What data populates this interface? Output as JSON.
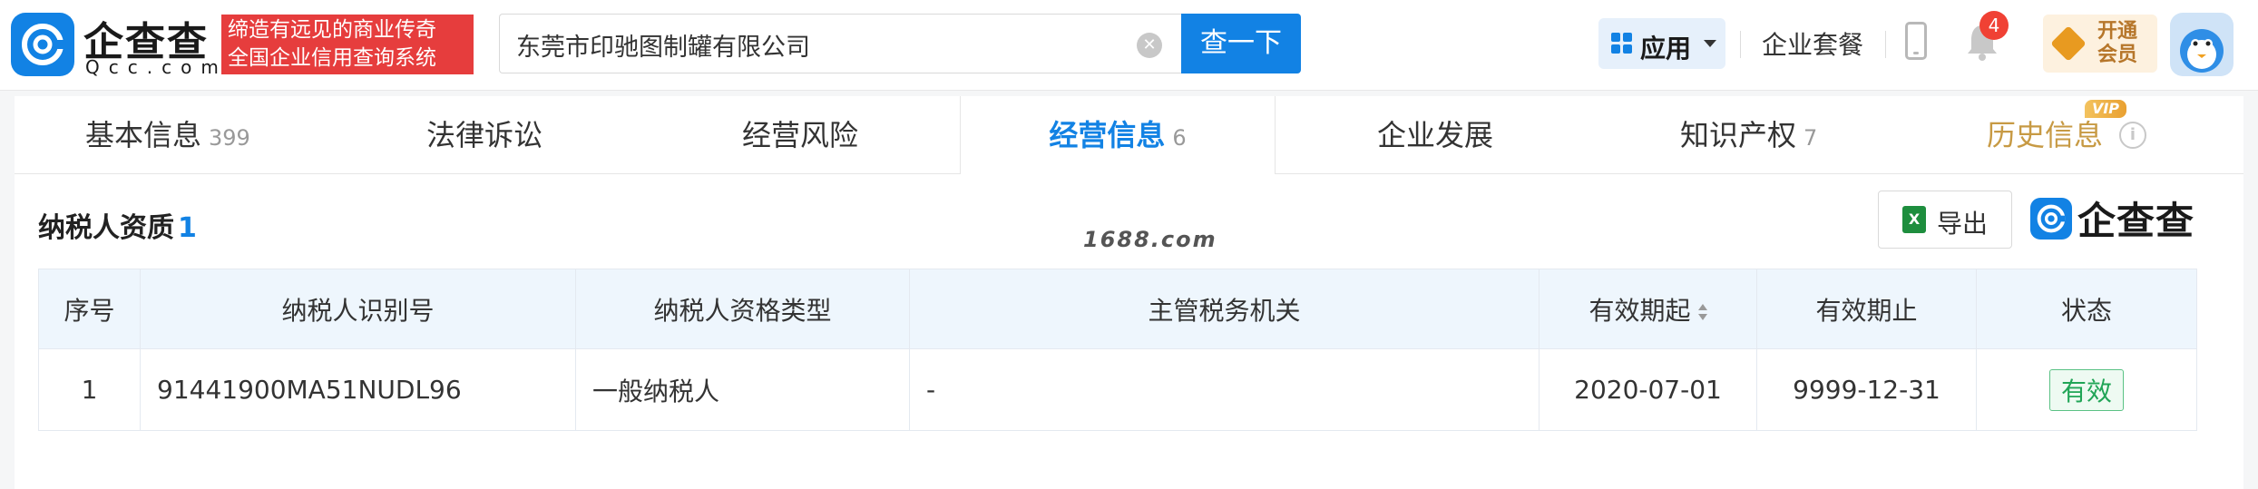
{
  "header": {
    "logo_cn": "企查查",
    "logo_en": "Qcc.com",
    "slogan_line1": "缔造有远见的商业传奇",
    "slogan_line2": "全国企业信用查询系统",
    "search_value": "东莞市印驰图制罐有限公司",
    "search_button": "查一下",
    "apps_label": "应用",
    "package_label": "企业套餐",
    "notification_count": "4",
    "vip_line1": "开通",
    "vip_line2": "会员",
    "colors": {
      "brand": "#1282e4",
      "slogan_bg": "#e63d3d"
    }
  },
  "tabs": [
    {
      "label": "基本信息",
      "count": "399"
    },
    {
      "label": "法律诉讼",
      "count": ""
    },
    {
      "label": "经营风险",
      "count": ""
    },
    {
      "label": "经营信息",
      "count": "6",
      "active": true
    },
    {
      "label": "企业发展",
      "count": ""
    },
    {
      "label": "知识产权",
      "count": "7"
    },
    {
      "label": "历史信息",
      "count": "",
      "badge": "VIP"
    }
  ],
  "section": {
    "title": "纳税人资质",
    "count": "1",
    "watermark": "1688.com",
    "export_label": "导出",
    "brand": "企查查"
  },
  "table": {
    "headers": [
      "序号",
      "纳税人识别号",
      "纳税人资格类型",
      "主管税务机关",
      "有效期起",
      "有效期止",
      "状态"
    ],
    "rows": [
      [
        "1",
        "91441900MA51NUDL96",
        "一般纳税人",
        "-",
        "2020-07-01",
        "9999-12-31",
        "有效"
      ]
    ]
  }
}
